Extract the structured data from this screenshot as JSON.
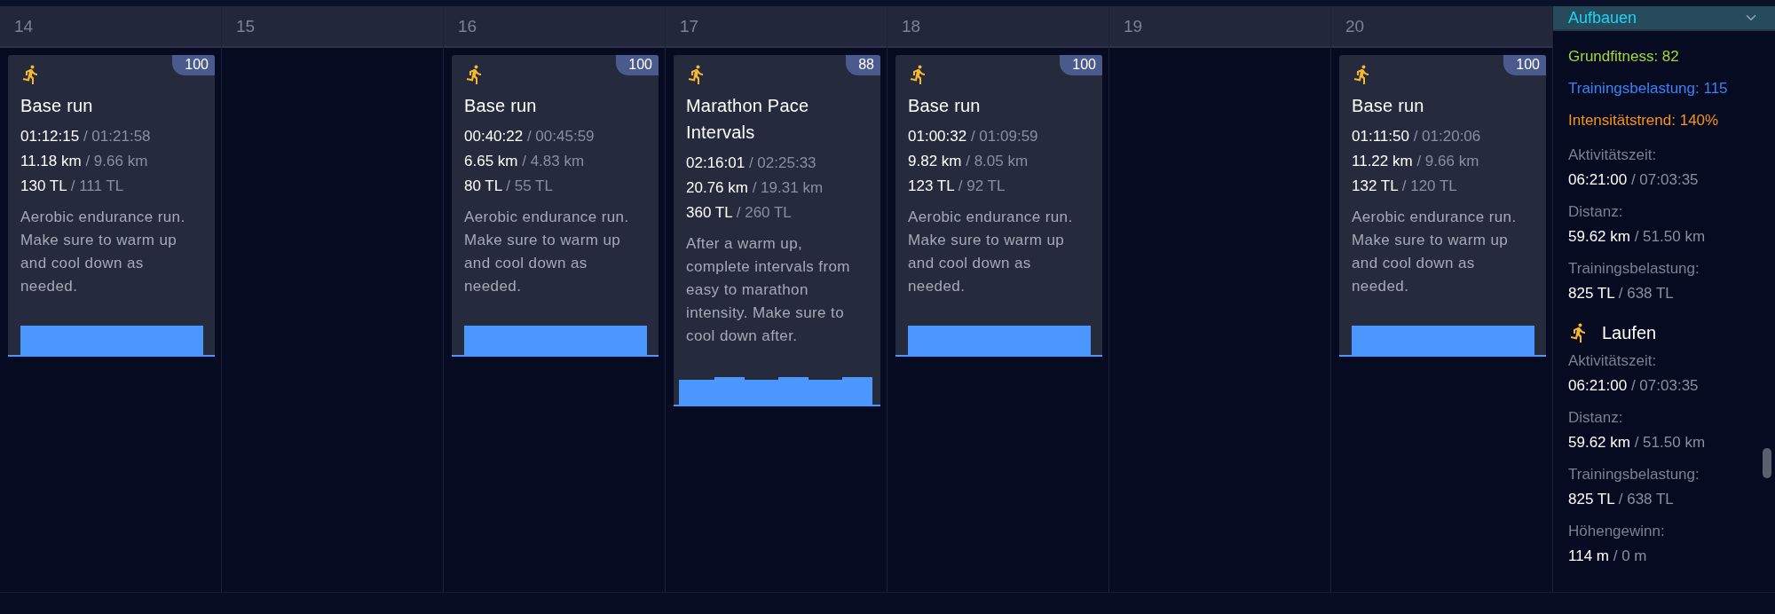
{
  "days": [
    {
      "date": "14",
      "workouts": [
        {
          "kind": "steady",
          "score": "100",
          "title": "Base run",
          "stats": [
            {
              "actual": "01:12:15",
              "planned": "/ 01:21:58"
            },
            {
              "actual": "11.18 km",
              "planned": "/ 9.66 km"
            },
            {
              "actual": "130 TL",
              "planned": "/ 111 TL"
            }
          ],
          "description": "Aerobic endurance run. Make sure to warm up and cool down as needed."
        }
      ]
    },
    {
      "date": "15"
    },
    {
      "date": "16",
      "workouts": [
        {
          "kind": "steady",
          "score": "100",
          "title": "Base run",
          "stats": [
            {
              "actual": "00:40:22",
              "planned": "/ 00:45:59"
            },
            {
              "actual": "6.65 km",
              "planned": "/ 4.83 km"
            },
            {
              "actual": "80 TL",
              "planned": "/ 55 TL"
            }
          ],
          "description": "Aerobic endurance run. Make sure to warm up and cool down as needed."
        }
      ]
    },
    {
      "date": "17",
      "workouts": [
        {
          "kind": "intervals",
          "score": "88",
          "title": "Marathon Pace Intervals",
          "stats": [
            {
              "actual": "02:16:01",
              "planned": "/ 02:25:33"
            },
            {
              "actual": "20.76 km",
              "planned": "/ 19.31 km"
            },
            {
              "actual": "360 TL",
              "planned": "/ 260 TL"
            }
          ],
          "description": "After a warm up, complete intervals from easy to marathon intensity. Make sure to cool down after."
        }
      ]
    },
    {
      "date": "18",
      "workouts": [
        {
          "kind": "steady",
          "score": "100",
          "title": "Base run",
          "stats": [
            {
              "actual": "01:00:32",
              "planned": "/ 01:09:59"
            },
            {
              "actual": "9.82 km",
              "planned": "/ 8.05 km"
            },
            {
              "actual": "123 TL",
              "planned": "/ 92 TL"
            }
          ],
          "description": "Aerobic endurance run. Make sure to warm up and cool down as needed."
        }
      ]
    },
    {
      "date": "19"
    },
    {
      "date": "20",
      "workouts": [
        {
          "kind": "steady",
          "score": "100",
          "title": "Base run",
          "stats": [
            {
              "actual": "01:11:50",
              "planned": "/ 01:20:06"
            },
            {
              "actual": "11.22 km",
              "planned": "/ 9.66 km"
            },
            {
              "actual": "132 TL",
              "planned": "/ 120 TL"
            }
          ],
          "description": "Aerobic endurance run. Make sure to warm up and cool down as needed."
        }
      ]
    }
  ],
  "summary": {
    "phase": "Aufbauen",
    "metrics": [
      {
        "text": "Grundfitness: 82",
        "color": "#a3d63a"
      },
      {
        "text": "Trainingsbelastung: 115",
        "color": "#3b82f6"
      },
      {
        "text": "Intensitätstrend: 140%",
        "color": "#f7931e"
      }
    ],
    "totals": [
      {
        "label": "Aktivitätszeit:",
        "actual": "06:21:00",
        "planned": "/ 07:03:35"
      },
      {
        "label": "Distanz:",
        "actual": "59.62 km",
        "planned": "/ 51.50 km"
      },
      {
        "label": "Trainingsbelastung:",
        "actual": "825 TL",
        "planned": "/ 638 TL"
      }
    ],
    "sport": {
      "name": "Laufen",
      "totals": [
        {
          "label": "Aktivitätszeit:",
          "actual": "06:21:00",
          "planned": "/ 07:03:35"
        },
        {
          "label": "Distanz:",
          "actual": "59.62 km",
          "planned": "/ 51.50 km"
        },
        {
          "label": "Trainingsbelastung:",
          "actual": "825 TL",
          "planned": "/ 638 TL"
        },
        {
          "label": "Höhengewinn:",
          "actual": "114 m",
          "planned": "/ 0 m"
        }
      ]
    }
  }
}
